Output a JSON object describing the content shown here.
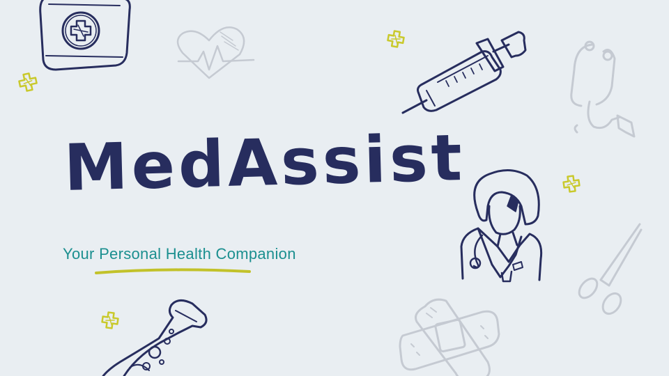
{
  "slide": {
    "title": "MedAssist",
    "subtitle": "Your Personal Health Companion"
  },
  "colors": {
    "background": "#e9eef2",
    "title": "#272d5e",
    "subtitle": "#1b8f8f",
    "underline": "#c2c22a",
    "doodle_dark": "#272d5e",
    "doodle_light": "#c5cad2",
    "plus_accent": "#c9c92c"
  },
  "doodles": [
    "first-aid-kit-icon",
    "heart-monitor-icon",
    "syringe-icon",
    "stethoscope-icon",
    "doctor-icon",
    "scissors-icon",
    "bandage-icon",
    "flask-icon",
    "plus-icon"
  ]
}
